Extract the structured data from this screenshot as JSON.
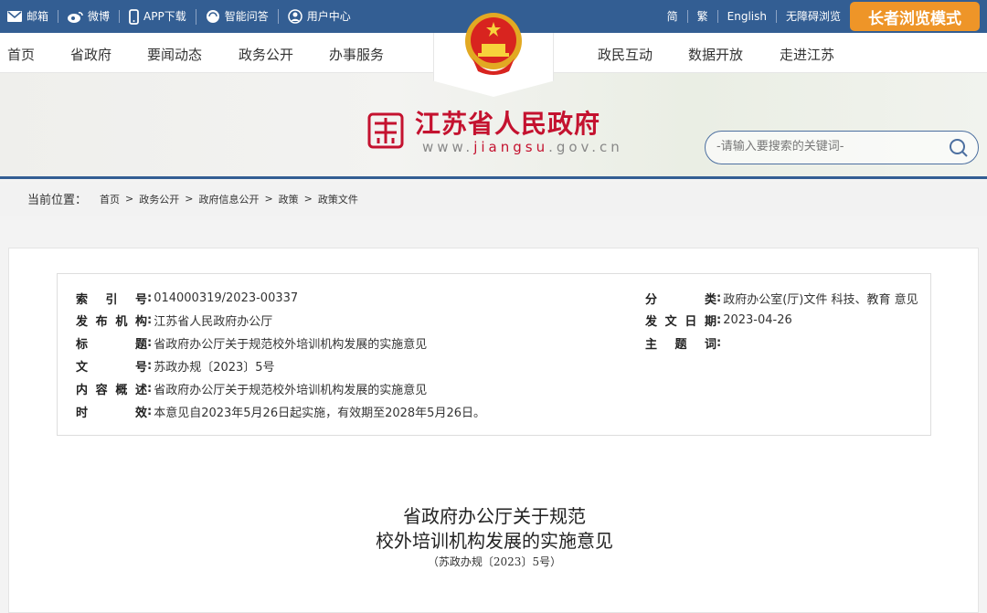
{
  "topbar": {
    "left": [
      {
        "icon": "mail-icon",
        "label": "邮箱"
      },
      {
        "icon": "weibo-icon",
        "label": "微博"
      },
      {
        "icon": "phone-icon",
        "label": "APP下载"
      },
      {
        "icon": "chat-icon",
        "label": "智能问答"
      },
      {
        "icon": "user-icon",
        "label": "用户中心"
      }
    ],
    "right": [
      "简",
      "繁",
      "English",
      "无障碍浏览"
    ],
    "elder_mode": "长者浏览模式",
    "accent": "#335e93",
    "elder_color": "#ee9528"
  },
  "nav": {
    "left": [
      "首页",
      "省政府",
      "要闻动态",
      "政务公开",
      "办事服务"
    ],
    "right": [
      "政民互动",
      "数据开放",
      "走进江苏"
    ]
  },
  "brand": {
    "name": "江苏省人民政府",
    "url_pre": "www.",
    "url_mid": "jiangsu",
    "url_post": ".gov.cn",
    "color": "#c4122f"
  },
  "search": {
    "placeholder": "-请输入要搜索的关键词-"
  },
  "breadcrumb": {
    "label": "当前位置：",
    "items": [
      "首页",
      "政务公开",
      "政府信息公开",
      "政策",
      "政策文件"
    ]
  },
  "info": {
    "left": [
      {
        "k": [
          "索",
          "引",
          "号"
        ],
        "v": "014000319/2023-00337"
      },
      {
        "k": [
          "发",
          "布",
          "机",
          "构"
        ],
        "v": "江苏省人民政府办公厅"
      },
      {
        "k": [
          "标",
          "题"
        ],
        "v": "省政府办公厅关于规范校外培训机构发展的实施意见"
      },
      {
        "k": [
          "文",
          "号"
        ],
        "v": "苏政办规〔2023〕5号"
      },
      {
        "k": [
          "内",
          "容",
          "概",
          "述"
        ],
        "v": "省政府办公厅关于规范校外培训机构发展的实施意见"
      },
      {
        "k": [
          "时",
          "效"
        ],
        "v": "本意见自2023年5月26日起实施，有效期至2028年5月26日。"
      }
    ],
    "right": [
      {
        "k": [
          "分",
          "类"
        ],
        "v": "政府办公室(厅)文件 科技、教育 意见"
      },
      {
        "k": [
          "发",
          "文",
          "日",
          "期"
        ],
        "v": "2023-04-26"
      },
      {
        "k": [
          "主",
          "题",
          "词"
        ],
        "v": ""
      }
    ]
  },
  "doc": {
    "title1": "省政府办公厅关于规范",
    "title2": "校外培训机构发展的实施意见",
    "number": "（苏政办规〔2023〕5号）"
  }
}
